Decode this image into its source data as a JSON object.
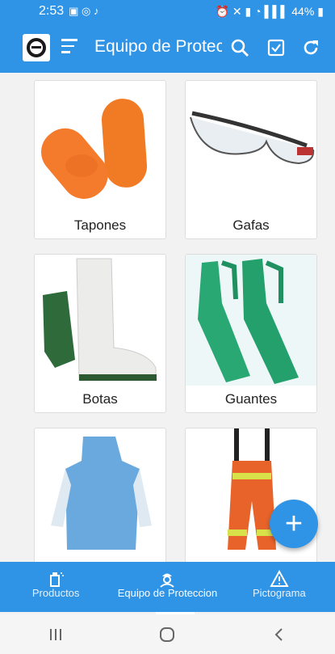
{
  "status_bar": {
    "time": "2:53",
    "battery": "44%"
  },
  "app_bar": {
    "title": "Equipo de Protecc"
  },
  "products": [
    {
      "label": "Tapones"
    },
    {
      "label": "Gafas"
    },
    {
      "label": "Botas"
    },
    {
      "label": "Guantes"
    },
    {
      "label": ""
    },
    {
      "label": ""
    }
  ],
  "fab": {
    "symbol": "+"
  },
  "bottom_nav": [
    {
      "label": "Productos",
      "icon": "spray-icon"
    },
    {
      "label": "Equipo de Proteccion",
      "icon": "worker-icon"
    },
    {
      "label": "Pictograma",
      "icon": "warning-icon"
    }
  ],
  "colors": {
    "primary": "#2f93e6",
    "background": "#f2f2f2"
  }
}
